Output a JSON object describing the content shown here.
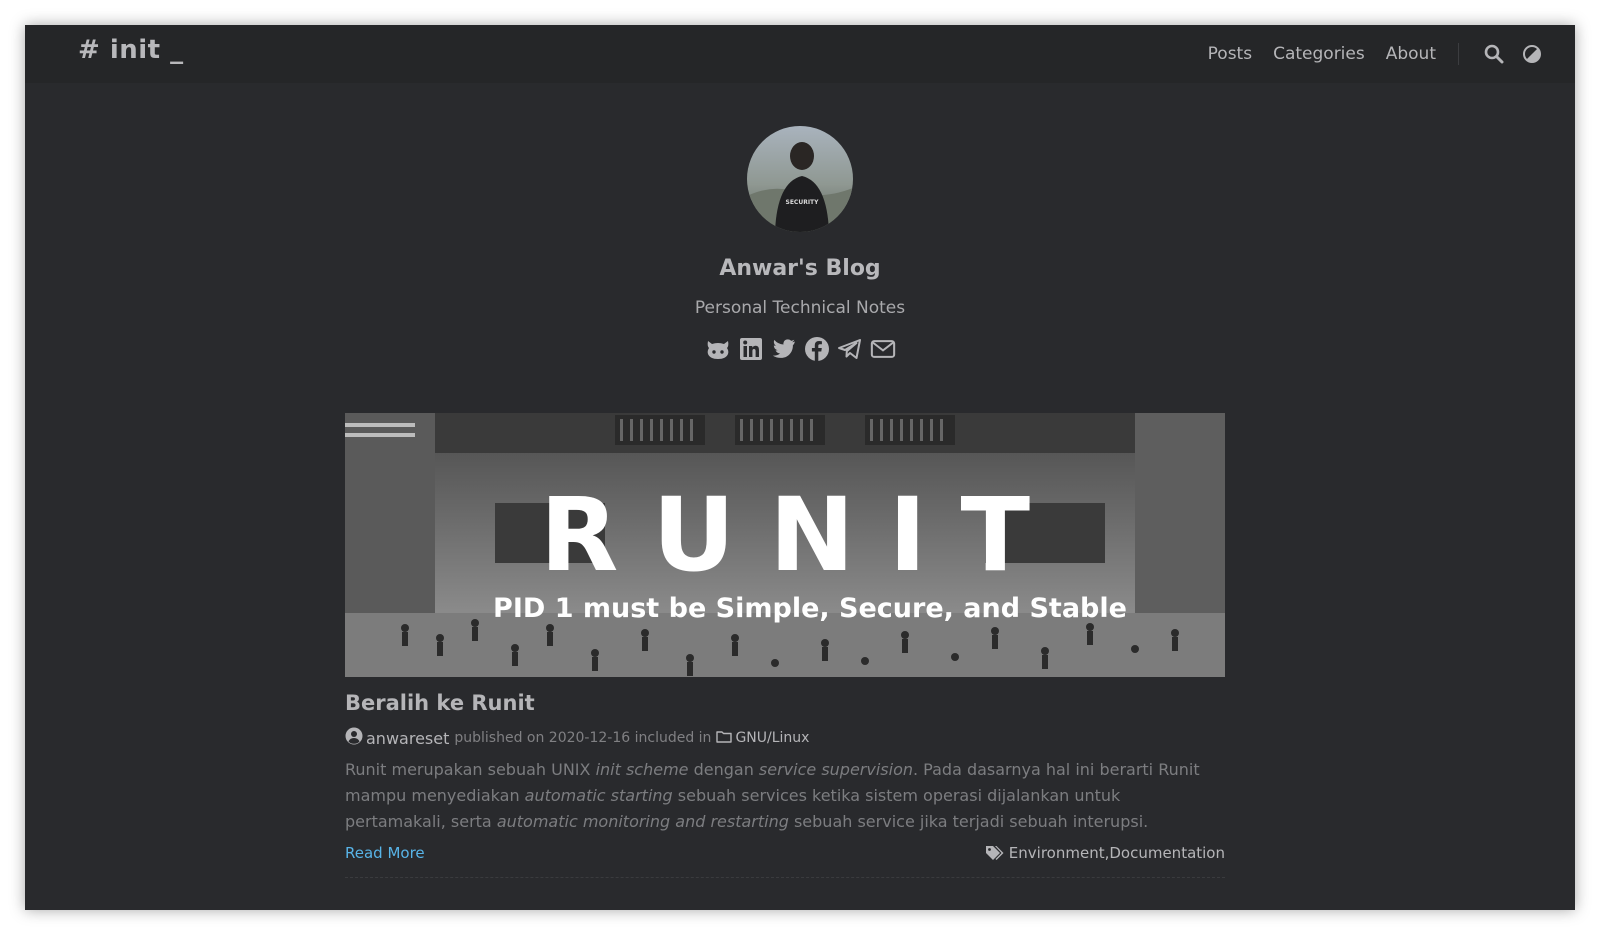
{
  "header": {
    "logo": "# init _",
    "nav": [
      {
        "label": "Posts"
      },
      {
        "label": "Categories"
      },
      {
        "label": "About"
      }
    ],
    "icons": [
      "search-icon",
      "theme-toggle-icon"
    ]
  },
  "profile": {
    "avatar_icon": "avatar",
    "title": "Anwar's Blog",
    "subtitle": "Personal Technical Notes",
    "social": [
      "github-icon",
      "linkedin-icon",
      "twitter-icon",
      "facebook-icon",
      "telegram-icon",
      "email-icon"
    ]
  },
  "post": {
    "cover": {
      "title": "RUNIT",
      "subtitle": "PID 1 must be Simple, Secure, and Stable"
    },
    "title": "Beralih ke Runit",
    "author": "anwareset",
    "published_on": "published on 2020-12-16 included in",
    "category": "GNU/Linux",
    "summary": {
      "p1": "Runit merupakan sebuah UNIX ",
      "i1": "init scheme",
      "p2": " dengan ",
      "i2": "service supervision",
      "p3": ". Pada dasarnya hal ini berarti Runit mampu menyediakan ",
      "i3": "automatic starting",
      "p4": " sebuah services ketika sistem operasi dijalankan untuk pertamakali, serta ",
      "i4": "automatic monitoring and restarting",
      "p5": " sebuah service jika terjadi sebuah interupsi."
    },
    "read_more": "Read More",
    "tags": [
      "Environment",
      "Documentation"
    ],
    "tag_sep": ", "
  },
  "colors": {
    "background": "#292a2d",
    "header": "#252628",
    "text": "#b5b5b8",
    "link": "#58b4e8"
  }
}
